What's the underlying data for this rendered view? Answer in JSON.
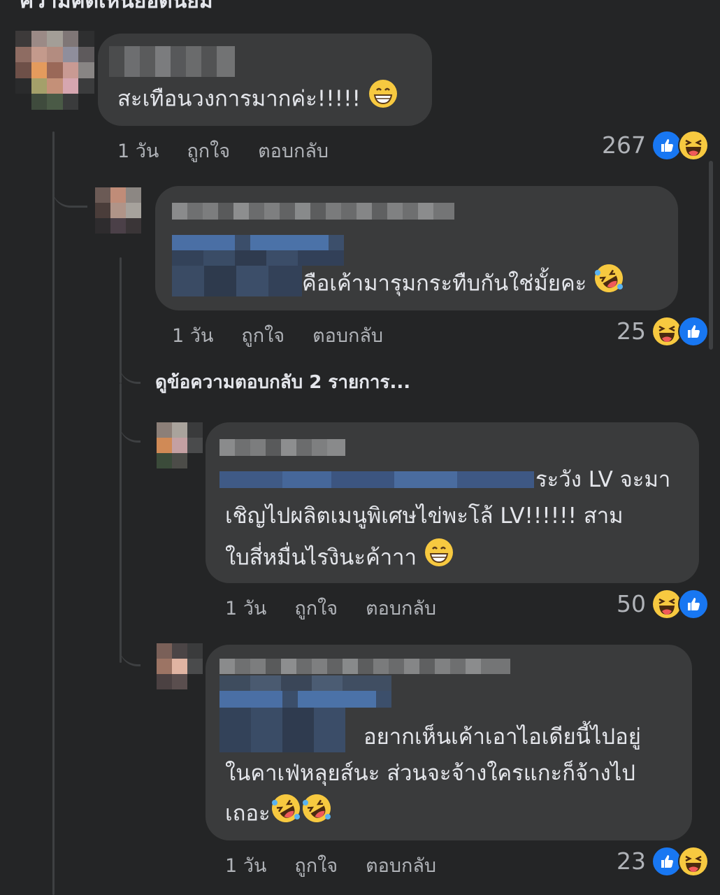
{
  "section_title": "ความคิดเห็นยอดนิยม",
  "actions": {
    "like": "ถูกใจ",
    "reply": "ตอบกลับ"
  },
  "comments": [
    {
      "time": "1 วัน",
      "text": "สะเทือนวงการมากค่ะ!!!!!",
      "reaction_count": "267",
      "reactions": [
        "like-icon",
        "haha-icon"
      ]
    },
    {
      "time": "1 วัน",
      "text": "คือเค้ามารุมกระทืบกันใช่มั้ยคะ",
      "reaction_count": "25",
      "reactions": [
        "haha-icon",
        "like-icon"
      ]
    },
    {
      "time": "1 วัน",
      "text_line1": "ระวัง LV จะมา",
      "text_line2": "เชิญไปผลิตเมนูพิเศษไข่พะโล้ LV!!!!!! สาม",
      "text_line3": "ใบสี่หมื่นไรงินะค้าาา",
      "reaction_count": "50",
      "reactions": [
        "haha-icon",
        "like-icon"
      ]
    },
    {
      "time": "1 วัน",
      "text_line1": "อยากเห็นเค้าเอาไอเดียนี้ไปอยู่",
      "text_line2": "ในคาเฟ่หลุยส์นะ ส่วนจะจ้างใครแกะก็จ้างไป",
      "text_line3": "เถอะ",
      "reaction_count": "23",
      "reactions": [
        "like-icon",
        "haha-icon"
      ]
    }
  ],
  "view_more_replies": "ดูข้อความตอบกลับ 2 รายการ...",
  "colors": {
    "background": "#242526",
    "bubble": "#3a3b3c",
    "meta": "#b0b3b8",
    "like_blue": "#1877f2",
    "emoji_yellow": "#f7c940"
  }
}
